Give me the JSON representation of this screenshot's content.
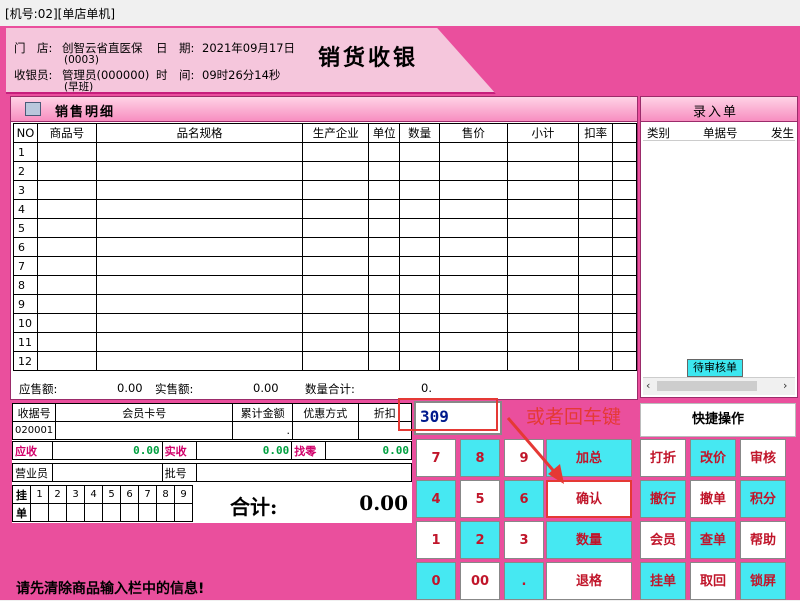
{
  "window": {
    "title": "[机号:02][单店单机]"
  },
  "header": {
    "store_label": "门　店:",
    "store_value": "创智云省直医保",
    "store_code": "(0003)",
    "date_label": "日　期:",
    "date_value": "2021年09月17日",
    "cashier_label": "收银员:",
    "cashier_value": "管理员(000000)",
    "shift": "(早班)",
    "time_label": "时　间:",
    "time_value": "09时26分14秒",
    "brand": "销货收银"
  },
  "sales": {
    "title": "销售明细",
    "columns": [
      "NO",
      "商品号",
      "品名规格",
      "生产企业",
      "单位",
      "数量",
      "售价",
      "小计",
      "扣率",
      ""
    ],
    "rows": [
      "1",
      "2",
      "3",
      "4",
      "5",
      "6",
      "7",
      "8",
      "9",
      "10",
      "11",
      "12"
    ],
    "summary": {
      "due_label": "应售额:",
      "due_value": "0.00",
      "actual_label": "实售额:",
      "actual_value": "0.00",
      "qty_label": "数量合计:",
      "qty_value": "0."
    }
  },
  "entry_form": {
    "title": "录入单",
    "columns": [
      "类别",
      "单据号",
      "发生"
    ],
    "pending_button": "待审核单"
  },
  "member": {
    "receipt_no_label": "收据号",
    "receipt_no_value": "020001",
    "card_label": "会员卡号",
    "total_amount_label": "累计金额",
    "total_amount_value": ".",
    "discount_mode_label": "优惠方式",
    "discount_label": "折扣"
  },
  "payment": {
    "due_label": "应收",
    "due_value": "0.00",
    "received_label": "实收",
    "received_value": "0.00",
    "change_label": "找零",
    "change_value": "0.00",
    "salesperson_label": "营业员",
    "batch_label": "批号",
    "hang_label": "挂",
    "hang_label2": "单",
    "hang_slots": [
      "1",
      "2",
      "3",
      "4",
      "5",
      "6",
      "7",
      "8",
      "9"
    ],
    "total_label": "合计:",
    "total_value": "0.00"
  },
  "status_message": "请先清除商品输入栏中的信息!",
  "input": {
    "value": "309"
  },
  "annotation_hint": "或者回车键",
  "quick_ops": "快捷操作",
  "keypad": {
    "k7": "7",
    "k8": "8",
    "k9": "9",
    "k4": "4",
    "k5": "5",
    "k6": "6",
    "k1": "1",
    "k2": "2",
    "k3": "3",
    "k0": "0",
    "k00": "00",
    "kdot": ".",
    "add_total": "加总",
    "confirm": "确认",
    "quantity": "数量",
    "return": "退格"
  },
  "functions": {
    "discount": "打折",
    "change_price": "改价",
    "review": "审核",
    "cancel_line": "撤行",
    "cancel_order": "撤单",
    "points": "积分",
    "member": "会员",
    "lookup": "查单",
    "help": "帮助",
    "hang": "挂单",
    "retrieve": "取回",
    "lock": "锁屏"
  },
  "colors": {
    "frame": "#ea4f9d",
    "banner": "#f5c6dc",
    "key_cyan": "#46e8f2",
    "key_text": "#c0152a",
    "annotation": "#e53935",
    "money_green": "#00a040"
  }
}
